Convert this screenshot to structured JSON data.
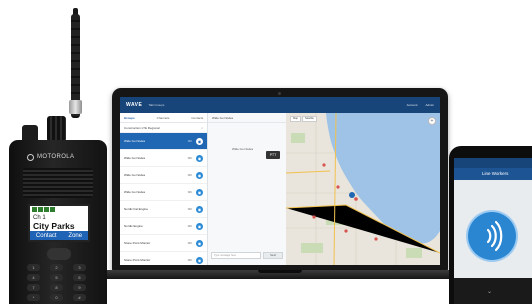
{
  "laptop": {
    "app": {
      "brand": "WAVE",
      "menu_label": "Talk Groups",
      "header_right": [
        "Account",
        "Admin"
      ],
      "tabs": [
        "Groups",
        "Channels",
        "Contacts"
      ],
      "active_tab": 0,
      "group_header": "Construction LTE Regional",
      "channels": [
        {
          "name": "Wide Go Nodes",
          "meta": "N/C",
          "active": true
        },
        {
          "name": "Wide Go Nodes",
          "meta": "N/C",
          "active": false
        },
        {
          "name": "Wide Go Nodes",
          "meta": "N/C",
          "active": false
        },
        {
          "name": "Wide Go Nodes",
          "meta": "N/C",
          "active": false
        },
        {
          "name": "Nordic Fat Engine",
          "meta": "N/C",
          "active": false
        },
        {
          "name": "Nordic Engine",
          "meta": "N/C",
          "active": false
        },
        {
          "name": "Stone Point Monitor",
          "meta": "N/C",
          "active": false
        },
        {
          "name": "Stone Point Monitor",
          "meta": "N/C",
          "active": false
        },
        {
          "name": "C.G.S.D.S Yes Channel 4",
          "meta": "N/C",
          "active": false
        }
      ],
      "pane_title": "Wide Go Nodes",
      "talker": "Wide Go Nodes",
      "pane_ptt": "PTT",
      "message_placeholder": "Type message here",
      "send_label": "Send",
      "map_buttons": [
        "Map",
        "Satellite"
      ],
      "map_zoom": "+"
    }
  },
  "radio": {
    "brand": "MOTOROLA",
    "channel": "Ch 1",
    "zone_name": "City Parks",
    "softkeys": [
      "Contact",
      "Zone"
    ],
    "keys": [
      "1",
      "2",
      "3",
      "4",
      "5",
      "6",
      "7",
      "8",
      "9",
      "*",
      "0",
      "#"
    ]
  },
  "phone": {
    "title": "Line Workers",
    "ptt_icon": "wireless-signal-icon",
    "chevron": "⌄"
  },
  "colors": {
    "app_header": "#17457a",
    "active_channel": "#1f66b3",
    "ptt_blue": "#2a86d1",
    "lake": "#9ec3e6",
    "radio_softkey": "#1e63b5"
  }
}
